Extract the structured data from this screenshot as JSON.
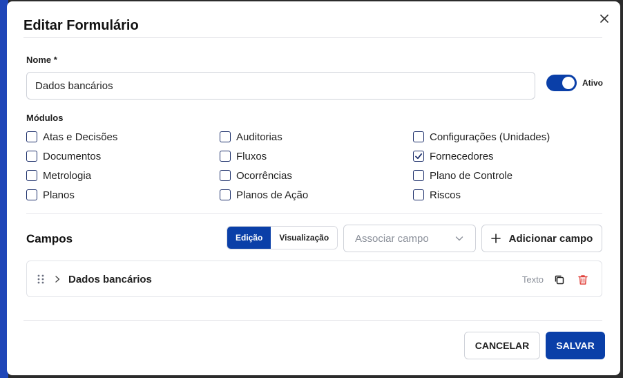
{
  "dialog": {
    "title": "Editar Formulário",
    "close_icon": "close-icon"
  },
  "form": {
    "name_label": "Nome *",
    "name_value": "Dados bancários",
    "active_label": "Ativo",
    "active": true
  },
  "modules": {
    "label": "Módulos",
    "items": [
      {
        "label": "Atas e Decisões",
        "checked": false
      },
      {
        "label": "Auditorias",
        "checked": false
      },
      {
        "label": "Configurações (Unidades)",
        "checked": false
      },
      {
        "label": "Documentos",
        "checked": false
      },
      {
        "label": "Fluxos",
        "checked": false
      },
      {
        "label": "Fornecedores",
        "checked": true
      },
      {
        "label": "Metrologia",
        "checked": false
      },
      {
        "label": "Ocorrências",
        "checked": false
      },
      {
        "label": "Plano de Controle",
        "checked": false
      },
      {
        "label": "Planos",
        "checked": false
      },
      {
        "label": "Planos de Ação",
        "checked": false
      },
      {
        "label": "Riscos",
        "checked": false
      }
    ]
  },
  "campos": {
    "title": "Campos",
    "mode_edit": "Edição",
    "mode_view": "Visualização",
    "associate_placeholder": "Associar campo",
    "add_button": "Adicionar campo",
    "fields": [
      {
        "name": "Dados bancários",
        "type": "Texto"
      }
    ]
  },
  "footer": {
    "cancel": "CANCELAR",
    "save": "SALVAR"
  },
  "colors": {
    "primary": "#0a3fa8",
    "danger": "#e0403a"
  }
}
